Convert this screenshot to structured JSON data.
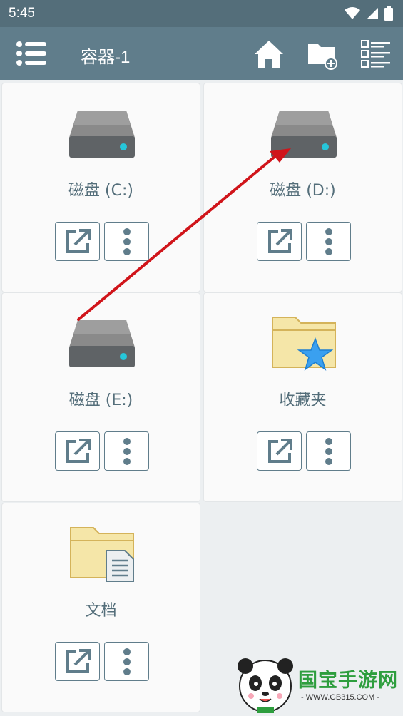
{
  "status_bar": {
    "time": "5:45"
  },
  "app_bar": {
    "title": "容器-1",
    "icons": [
      "menu-icon",
      "home-icon",
      "new-folder-icon",
      "checklist-icon"
    ]
  },
  "cards": [
    {
      "label": "磁盘 (C:)",
      "icon": "hard-drive-icon"
    },
    {
      "label": "磁盘 (D:)",
      "icon": "hard-drive-icon"
    },
    {
      "label": "磁盘 (E:)",
      "icon": "hard-drive-icon"
    },
    {
      "label": "收藏夹",
      "icon": "favorites-folder-icon"
    },
    {
      "label": "文档",
      "icon": "documents-folder-icon"
    }
  ],
  "card_actions": {
    "open": "open-external-icon",
    "more": "more-vertical-icon"
  },
  "watermark": {
    "text": "国宝手游网",
    "url": "- WWW.GB315.COM -"
  },
  "colors": {
    "app_bar": "#607d8b",
    "status_bar": "#546e7a",
    "accent": "#26c6da",
    "annotation_arrow": "#d0141a"
  }
}
